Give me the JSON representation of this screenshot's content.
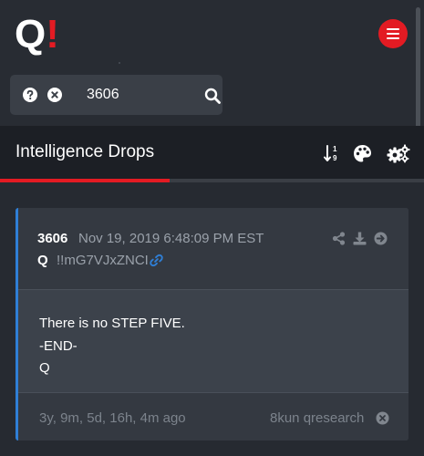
{
  "app": {
    "logo_letter": "Q",
    "logo_mark": "!",
    "brand_color": "#e31b23"
  },
  "search": {
    "value": "3606",
    "icons": [
      "help-icon",
      "clear-icon",
      "search-icon"
    ]
  },
  "section": {
    "title": "Intelligence Drops",
    "icons": [
      "sort-numeric-icon",
      "palette-icon",
      "settings-icon"
    ],
    "progress": 0.4
  },
  "post": {
    "number": "3606",
    "date": "Nov 19, 2019 6:48:09 PM EST",
    "author": "Q",
    "tripcode": "!!mG7VJxZNCI",
    "accent_color": "#2f7fd6",
    "lines": [
      "There is no STEP FIVE.",
      "-END-",
      "Q"
    ],
    "age": "3y, 9m, 5d, 16h, 4m ago",
    "board": "8kun qresearch",
    "actions": [
      "share-icon",
      "download-icon",
      "goto-icon"
    ]
  }
}
